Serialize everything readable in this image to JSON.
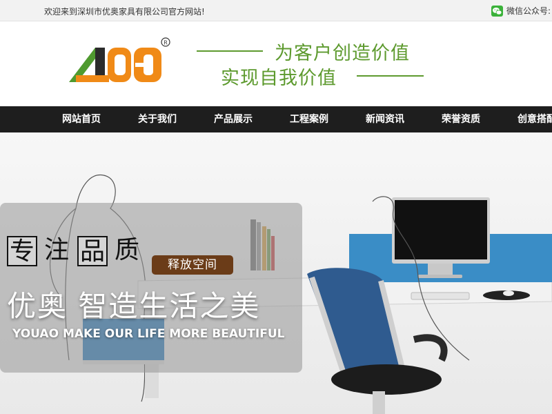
{
  "topbar": {
    "welcome": "欢迎来到深圳市优奥家具有限公司官方网站!",
    "wechat_label": "微信公众号:",
    "wechat_icon": "wechat-icon"
  },
  "header": {
    "logo_icon": "company-logo",
    "slogan_line1": "为客户创造价值",
    "slogan_line2": "实现自我价值",
    "accent_color": "#5d9a2e"
  },
  "nav": {
    "items": [
      {
        "label": "网站首页"
      },
      {
        "label": "关于我们"
      },
      {
        "label": "产品展示"
      },
      {
        "label": "工程案例"
      },
      {
        "label": "新闻资讯"
      },
      {
        "label": "荣誉资质"
      },
      {
        "label": "创意搭配"
      }
    ],
    "background": "#1e1e1e"
  },
  "banner": {
    "tag_chars": [
      "专",
      "注",
      "品",
      "质"
    ],
    "badge": "释放空间",
    "headline": "优奥 智造生活之美",
    "subline": "YOUAO MAKE OUR LIFE MORE BEAUTIFUL",
    "badge_color": "#6b3c18"
  }
}
